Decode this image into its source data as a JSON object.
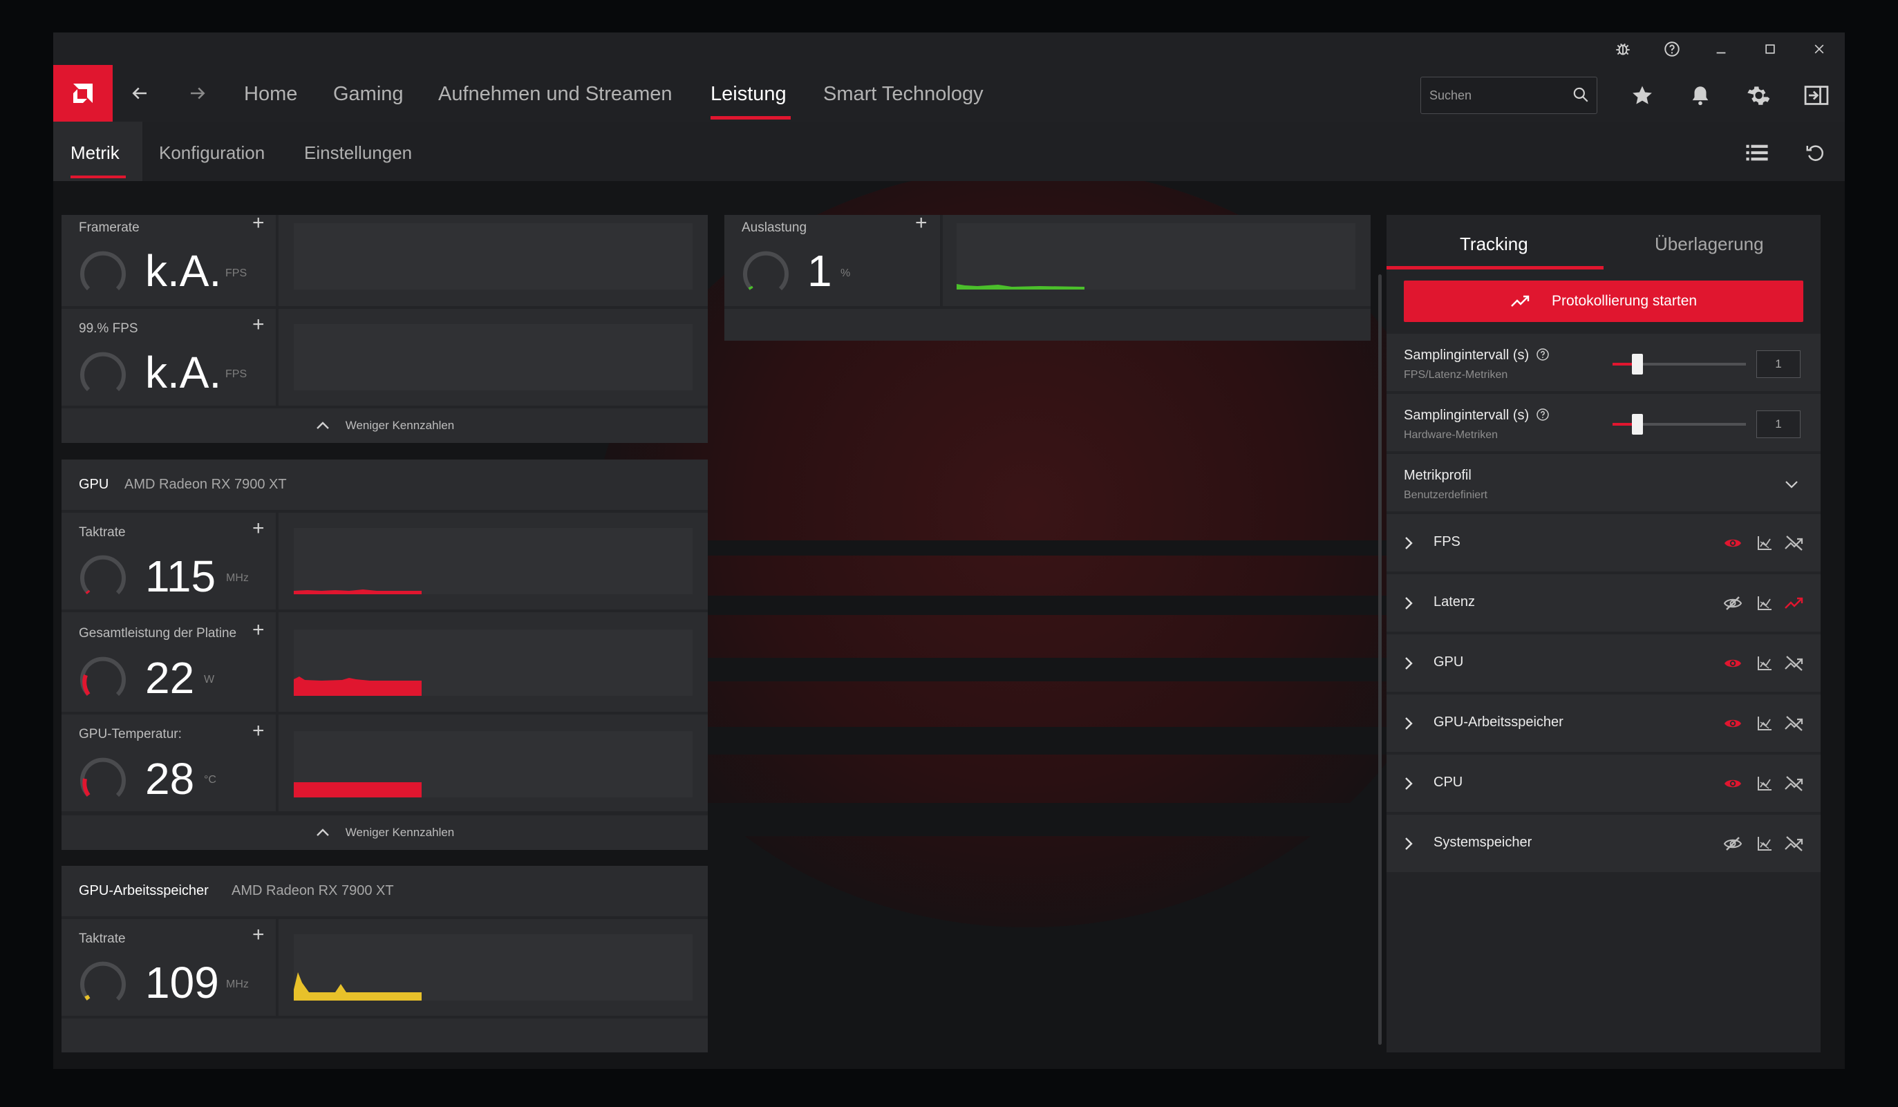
{
  "titlebar": {
    "icons": [
      "bug-report-icon",
      "help-icon",
      "minimize-icon",
      "maximize-icon",
      "close-icon"
    ]
  },
  "nav": {
    "tabs": [
      "Home",
      "Gaming",
      "Aufnehmen und Streamen",
      "Leistung",
      "Smart Technology"
    ],
    "active_tab": "Leistung",
    "search_placeholder": "Suchen"
  },
  "subnav": {
    "tabs": [
      "Metrik",
      "Konfiguration",
      "Einstellungen"
    ],
    "active_tab": "Metrik"
  },
  "fps_section": {
    "metrics": [
      {
        "label": "Framerate",
        "value": "k.A.",
        "unit": "FPS"
      },
      {
        "label": "99.% FPS",
        "value": "k.A.",
        "unit": "FPS"
      }
    ],
    "less_label": "Weniger Kennzahlen"
  },
  "cpu_section": {
    "metrics": [
      {
        "label": "Auslastung",
        "value": "1",
        "unit": "%",
        "color": "#4bbf2b"
      }
    ]
  },
  "gpu_section": {
    "title": "GPU",
    "device": "AMD Radeon RX 7900 XT",
    "metrics": [
      {
        "label": "Taktrate",
        "value": "115",
        "unit": "MHz",
        "color": "#e0162f"
      },
      {
        "label": "Gesamtleistung der Platine",
        "value": "22",
        "unit": "W",
        "color": "#e0162f"
      },
      {
        "label": "GPU-Temperatur:",
        "value": "28",
        "unit": "°C",
        "color": "#e0162f"
      }
    ],
    "less_label": "Weniger Kennzahlen"
  },
  "vram_section": {
    "title": "GPU-Arbeitsspeicher",
    "device": "AMD Radeon RX 7900 XT",
    "metrics": [
      {
        "label": "Taktrate",
        "value": "109",
        "unit": "MHz",
        "color": "#e8c12a"
      }
    ]
  },
  "right_panel": {
    "tabs": [
      "Tracking",
      "Überlagerung"
    ],
    "active_tab": "Tracking",
    "start_button": "Protokollierung starten",
    "sampling": [
      {
        "label": "Samplingintervall (s)",
        "sub": "FPS/Latenz-Metriken",
        "value": "1"
      },
      {
        "label": "Samplingintervall (s)",
        "sub": "Hardware-Metriken",
        "value": "1"
      }
    ],
    "profile": {
      "label": "Metrikprofil",
      "value": "Benutzerdefiniert"
    },
    "categories": [
      {
        "name": "FPS",
        "visible": true,
        "tracking": false
      },
      {
        "name": "Latenz",
        "visible": false,
        "tracking": true
      },
      {
        "name": "GPU",
        "visible": true,
        "tracking": false
      },
      {
        "name": "GPU-Arbeitsspeicher",
        "visible": true,
        "tracking": false
      },
      {
        "name": "CPU",
        "visible": true,
        "tracking": false
      },
      {
        "name": "Systemspeicher",
        "visible": false,
        "tracking": false
      }
    ]
  },
  "colors": {
    "accent": "#e0162f",
    "cpu_green": "#4bbf2b",
    "vram_yellow": "#e8c12a"
  }
}
